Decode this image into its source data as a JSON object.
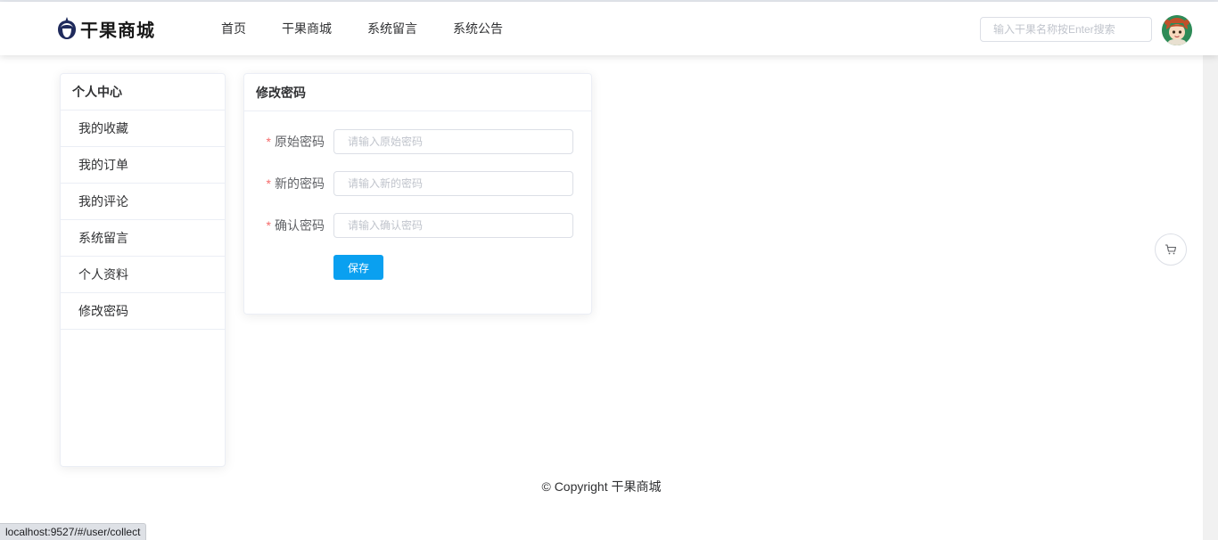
{
  "header": {
    "logo_text": "干果商城",
    "nav": [
      {
        "label": "首页"
      },
      {
        "label": "干果商城"
      },
      {
        "label": "系统留言"
      },
      {
        "label": "系统公告"
      }
    ],
    "search_placeholder": "输入干果名称按Enter搜索"
  },
  "sidebar": {
    "title": "个人中心",
    "items": [
      {
        "label": "我的收藏"
      },
      {
        "label": "我的订单"
      },
      {
        "label": "我的评论"
      },
      {
        "label": "系统留言"
      },
      {
        "label": "个人资料"
      },
      {
        "label": "修改密码"
      }
    ]
  },
  "form": {
    "title": "修改密码",
    "required_mark": "*",
    "fields": [
      {
        "label": "原始密码",
        "placeholder": "请输入原始密码",
        "value": ""
      },
      {
        "label": "新的密码",
        "placeholder": "请输入新的密码",
        "value": ""
      },
      {
        "label": "确认密码",
        "placeholder": "请输入确认密码",
        "value": ""
      }
    ],
    "save_label": "保存"
  },
  "footer": {
    "text": "© Copyright 干果商城"
  },
  "statusbar": {
    "url": "localhost:9527/#/user/collect"
  },
  "icons": {
    "logo": "acorn-icon",
    "cart": "cart-icon",
    "avatar": "user-avatar"
  },
  "colors": {
    "primary": "#0aa0f0",
    "required": "#f56c6c",
    "border": "#ebeef5"
  }
}
